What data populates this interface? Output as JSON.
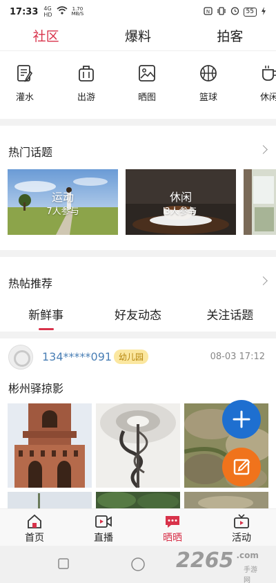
{
  "status": {
    "time": "17:33",
    "net_line1": "4G",
    "net_line2": "HD",
    "speed_value": "1.70",
    "speed_unit": "MB/S",
    "battery": "55"
  },
  "top_tabs": [
    {
      "label": "社区",
      "active": true
    },
    {
      "label": "爆料",
      "active": false
    },
    {
      "label": "拍客",
      "active": false
    }
  ],
  "categories": [
    {
      "label": "灌水",
      "icon": "note-edit-icon"
    },
    {
      "label": "出游",
      "icon": "suitcase-icon"
    },
    {
      "label": "晒图",
      "icon": "image-icon"
    },
    {
      "label": "篮球",
      "icon": "basketball-icon"
    },
    {
      "label": "休闲",
      "icon": "cup-icon"
    }
  ],
  "hot_topics": {
    "title": "热门话题",
    "items": [
      {
        "name": "运动",
        "count": "7人参与"
      },
      {
        "name": "休闲",
        "count": "3人参与"
      }
    ]
  },
  "hot_posts": {
    "title": "热帖推荐",
    "tabs": [
      {
        "label": "新鲜事",
        "active": true
      },
      {
        "label": "好友动态",
        "active": false
      },
      {
        "label": "关注话题",
        "active": false
      }
    ]
  },
  "post": {
    "username": "134*****091",
    "tag": "幼儿园",
    "time": "08-03 17:12",
    "title": "彬州驿掠影"
  },
  "bottom_nav": [
    {
      "label": "首页",
      "icon": "home-icon",
      "active": false
    },
    {
      "label": "直播",
      "icon": "live-video-icon",
      "active": false
    },
    {
      "label": "晒晒",
      "icon": "chat-bubble-icon",
      "active": true
    },
    {
      "label": "活动",
      "icon": "tv-icon",
      "active": false
    }
  ],
  "watermark": {
    "brand": "2265",
    "suffix": ".com",
    "sub": "手游网"
  },
  "colors": {
    "accent": "#d8324a",
    "fab_blue": "#1e6fd0",
    "fab_orange": "#f0731c",
    "username": "#4a7fb5"
  }
}
